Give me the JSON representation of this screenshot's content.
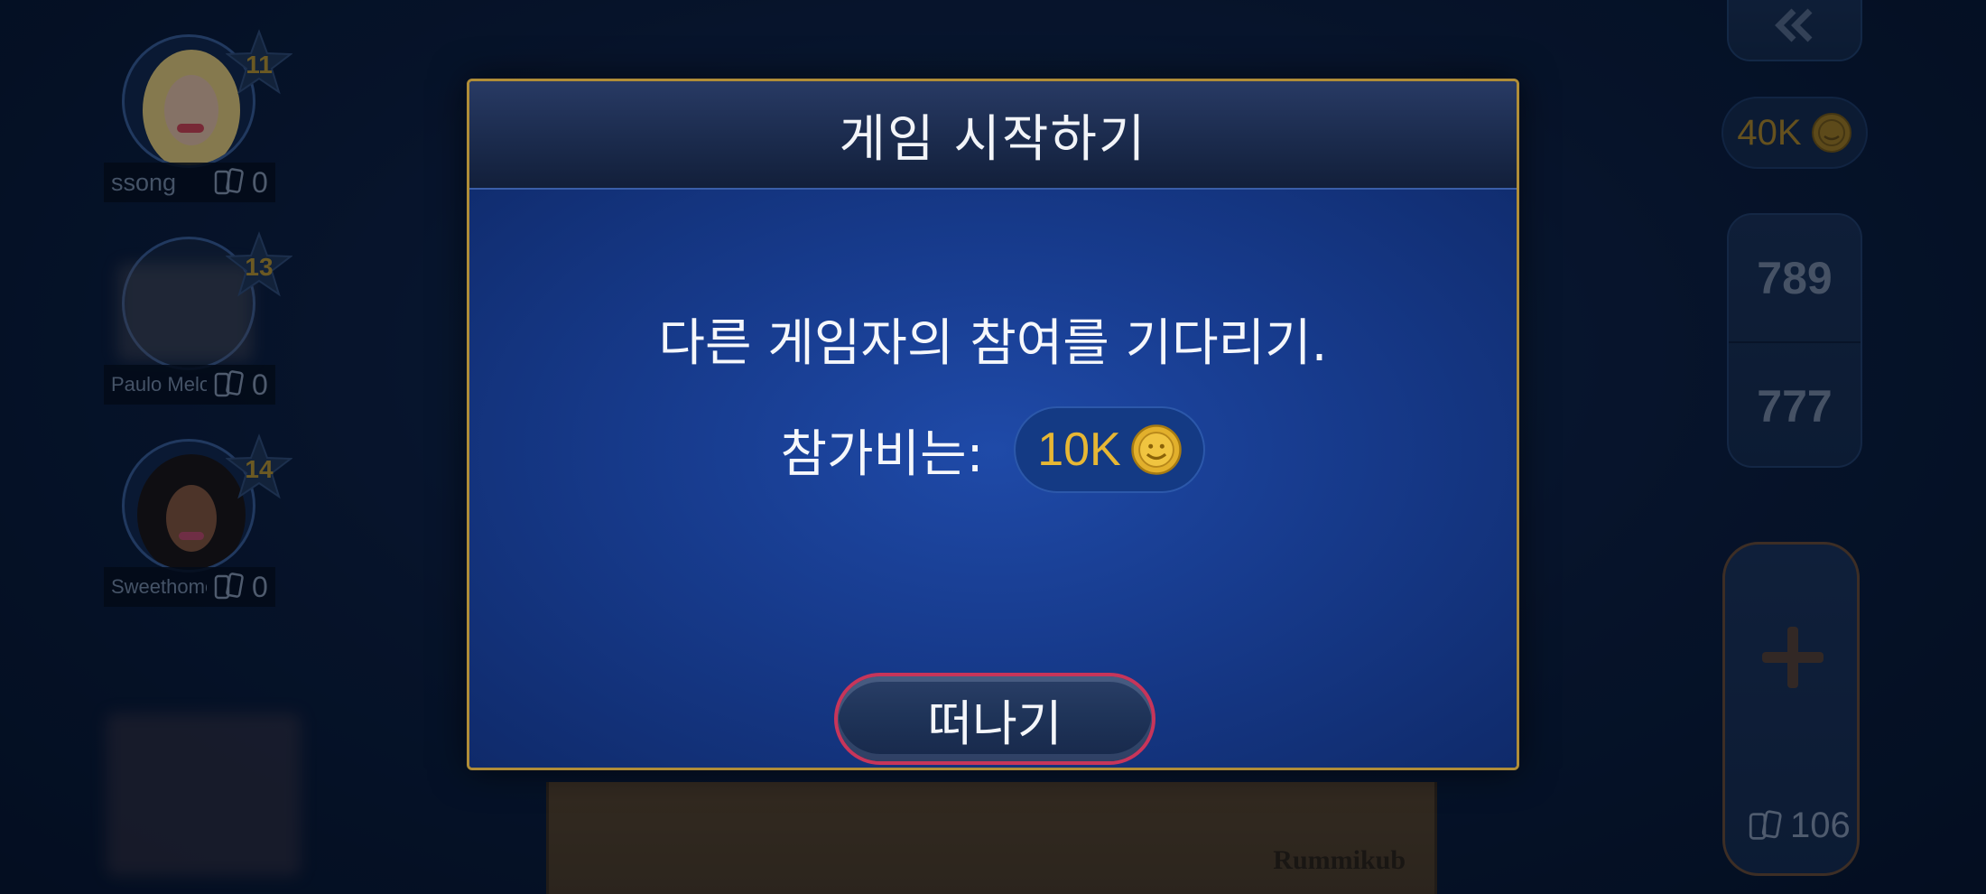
{
  "players": [
    {
      "name": "ssong",
      "level": "11",
      "tiles": "0"
    },
    {
      "name": "Paulo Melo",
      "level": "13",
      "tiles": "0"
    },
    {
      "name": "Sweethome",
      "level": "14",
      "tiles": "0"
    }
  ],
  "right_panel": {
    "coins": "40K",
    "scores": [
      "789",
      "777"
    ],
    "pool_count": "106",
    "back_icon": "double-chevron-left-icon",
    "draw_icon": "plus-icon"
  },
  "rack": {
    "logo": "Rummikub"
  },
  "modal": {
    "title": "게임 시작하기",
    "message": "다른 게임자의 참여를 기다리기.",
    "fee_label": "참가비는:",
    "fee_amount": "10K",
    "leave_button": "떠나기"
  },
  "colors": {
    "gold": "#e7b734",
    "modal_border": "#b08d38",
    "leave_border": "#c7355a",
    "background": "#0a1a38"
  }
}
